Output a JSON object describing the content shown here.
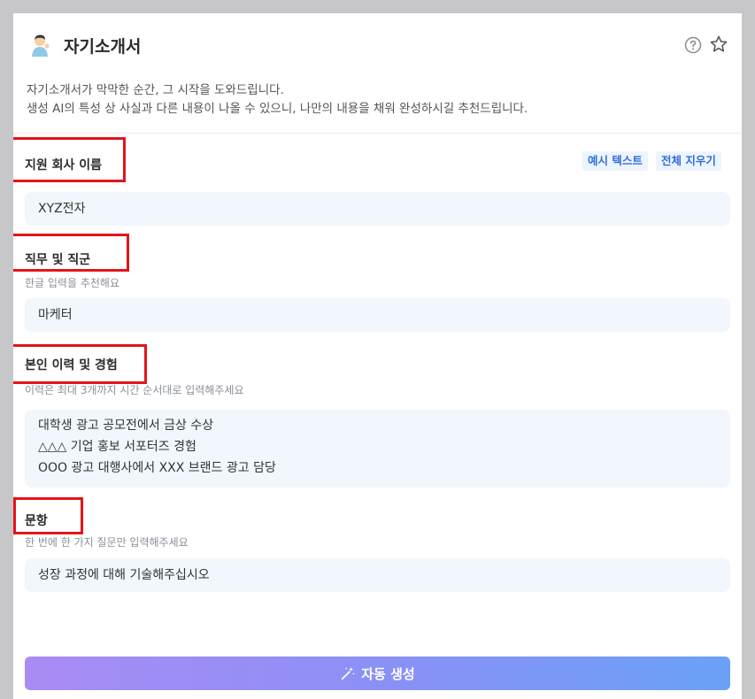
{
  "header": {
    "title": "자기소개서",
    "avatar_icon": "person-tipping-hand-icon",
    "help_icon": "question-circle-icon",
    "favorite_icon": "star-icon"
  },
  "description": {
    "line1": "자기소개서가 막막한 순간, 그 시작을 도와드립니다.",
    "line2": "생성 AI의 특성 상 사실과 다른 내용이 나올 수 있으니, 나만의 내용을 채워 완성하시길 추천드립니다."
  },
  "actions": {
    "example_text": "예시 텍스트",
    "clear_all": "전체 지우기"
  },
  "fields": {
    "company": {
      "label": "지원 회사 이름",
      "value": "XYZ전자"
    },
    "job": {
      "label": "직무 및 직군",
      "hint": "한글 입력을 추천해요",
      "value": "마케터"
    },
    "history": {
      "label": "본인 이력 및 경험",
      "hint": "이력은 최대 3개까지 시간 순서대로 입력해주세요",
      "lines": [
        "대학생 광고 공모전에서 금상 수상",
        "△△△ 기업 홍보 서포터즈 경험",
        "OOO 광고 대행사에서 XXX 브랜드 광고 담당"
      ]
    },
    "question": {
      "label": "문항",
      "hint": "한 번에 한 가지 질문만 입력해주세요",
      "value": "성장 과정에 대해 기술해주십시오"
    }
  },
  "generate_button": {
    "label": "자동 생성",
    "icon": "magic-wand-icon"
  },
  "colors": {
    "highlight_box": "#e3141b",
    "link": "#2f6fd6",
    "field_bg": "#f2f6fd",
    "gradient_start": "#a98cf4",
    "gradient_end": "#6aa1f7"
  }
}
